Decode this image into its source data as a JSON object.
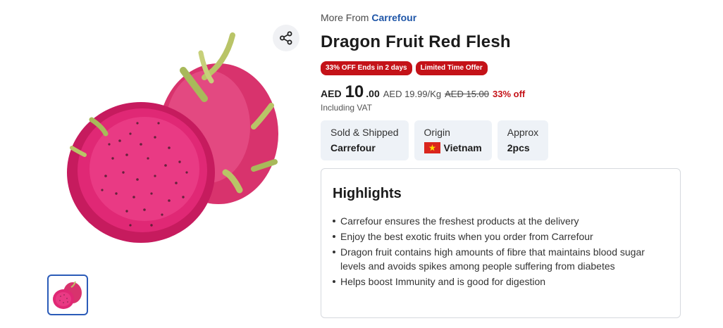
{
  "breadcrumb": {
    "prefix": "More From",
    "brand": "Carrefour"
  },
  "product": {
    "title": "Dragon Fruit Red Flesh"
  },
  "badges": [
    {
      "label": "33% OFF Ends in 2 days",
      "color": "#c41218"
    },
    {
      "label": "Limited Time Offer",
      "color": "#c41218"
    }
  ],
  "price": {
    "currency": "AED",
    "whole": "10",
    "decimal": ".00",
    "unit_price": "AED 19.99/Kg",
    "old_price": "AED 15.00",
    "discount": "33% off",
    "vat_note": "Including VAT"
  },
  "specs": [
    {
      "label": "Sold & Shipped",
      "value": "Carrefour"
    },
    {
      "label": "Origin",
      "value": "Vietnam",
      "icon": "vietnam-flag-icon"
    },
    {
      "label": "Approx",
      "value": "2pcs"
    }
  ],
  "highlights": {
    "title": "Highlights",
    "items": [
      "Carrefour ensures the freshest products at the delivery",
      "Enjoy the best exotic fruits when you order from Carrefour",
      "Dragon fruit contains high amounts of fibre that maintains blood sugar levels and avoids spikes among people suffering from diabetes",
      "Helps boost Immunity and is good for digestion"
    ]
  },
  "icons": {
    "share": "share-icon",
    "product_image": "dragon-fruit-image",
    "thumbnail": "dragon-fruit-thumbnail"
  },
  "colors": {
    "brand_link": "#1f56a8",
    "badge": "#c41218",
    "discount": "#c41218",
    "spec_bg": "#eef2f7",
    "thumb_border": "#2b5bb8"
  }
}
